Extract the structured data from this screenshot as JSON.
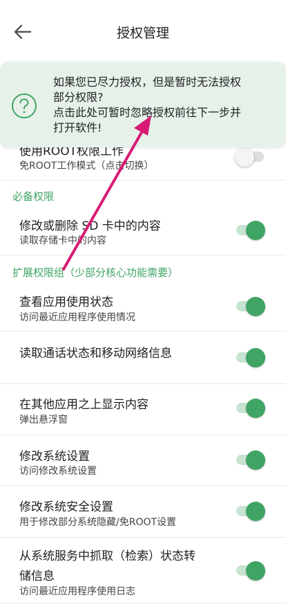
{
  "header": {
    "title": "授权管理"
  },
  "tip": {
    "lines": [
      "如果您已尽力授权，但是暂时无法授权",
      "部分权限?",
      "点击此处可暂时忽略授权前往下一步并",
      "打开软件!"
    ]
  },
  "root_mode": {
    "title": "使用ROOT权限工作",
    "subtitle": "免ROOT工作模式（点击切换）",
    "enabled": false
  },
  "sections": {
    "required": "必备权限",
    "extended": "扩展权限组（少部分核心功能需要）"
  },
  "required_items": [
    {
      "title": "修改或删除 SD 卡中的内容",
      "subtitle": "读取存储卡中的内容",
      "enabled": true
    }
  ],
  "extended_items": [
    {
      "title": "查看应用使用状态",
      "subtitle": "访问最近应用程序使用情况",
      "enabled": true
    },
    {
      "title": "读取通话状态和移动网络信息",
      "subtitle": "",
      "enabled": true
    },
    {
      "title": "在其他应用之上显示内容",
      "subtitle": "弹出悬浮窗",
      "enabled": true
    },
    {
      "title": "修改系统设置",
      "subtitle": "访问修改系统设置",
      "enabled": true
    },
    {
      "title": "修改系统安全设置",
      "subtitle": "用于修改部分系统隐藏/免ROOT设置",
      "enabled": true
    },
    {
      "title_line1": "从系统服务中抓取（检索）状态转",
      "title_line2": "储信息",
      "subtitle": "访问最近应用程序使用日志",
      "enabled": true
    }
  ],
  "colors": {
    "accent": "#3fa464",
    "tip_bg": "#e6f1ea",
    "arrow": "#d81b74"
  }
}
